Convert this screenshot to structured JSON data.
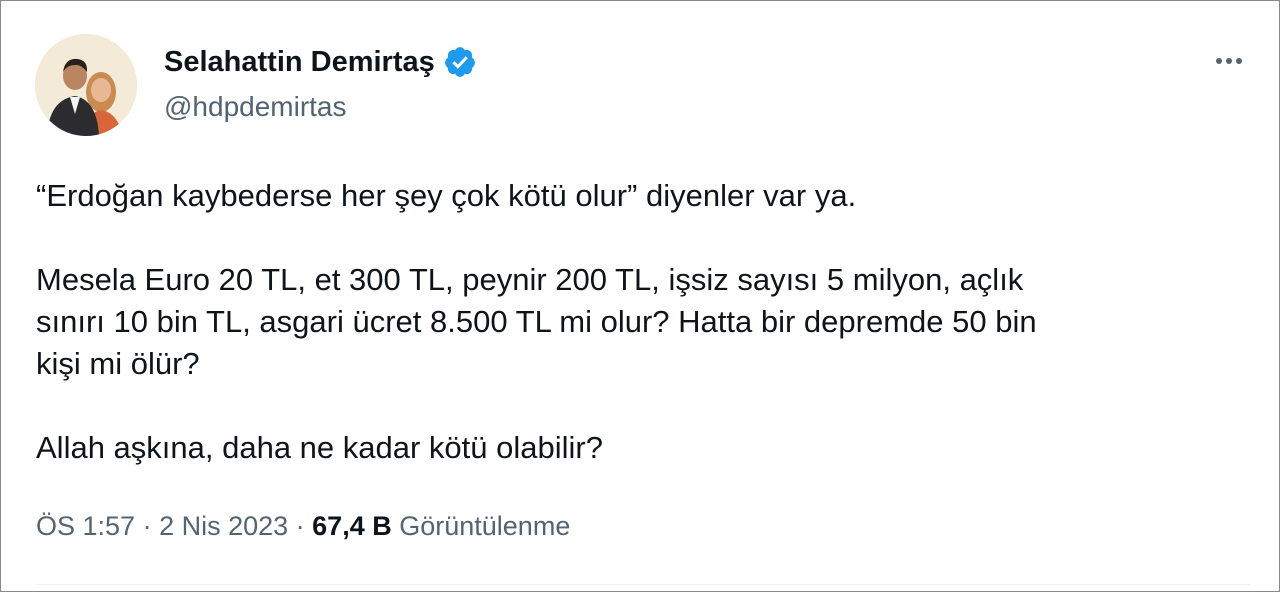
{
  "author": {
    "name": "Selahattin Demirtaş",
    "handle": "@hdpdemirtas",
    "verified_color": "#1d9bf0",
    "avatar_icon": "profile-photo"
  },
  "tweet": {
    "paragraphs": [
      "“Erdoğan kaybederse her şey çok kötü olur” diyenler var ya.",
      "Mesela Euro 20 TL, et 300 TL, peynir 200 TL, işsiz sayısı 5 milyon, açlık\nsınırı 10 bin TL, asgari ücret 8.500 TL mi olur? Hatta bir depremde 50 bin\nkişi mi ölür?",
      "Allah aşkına, daha ne kadar kötü olabilir?"
    ]
  },
  "meta": {
    "time": "ÖS 1:57",
    "separator": " · ",
    "date": "2 Nis 2023",
    "views_count": "67,4 B",
    "views_label": "Görüntülenme"
  },
  "colors": {
    "text": "#0f1419",
    "secondary": "#536471",
    "divider": "#eff3f4"
  }
}
